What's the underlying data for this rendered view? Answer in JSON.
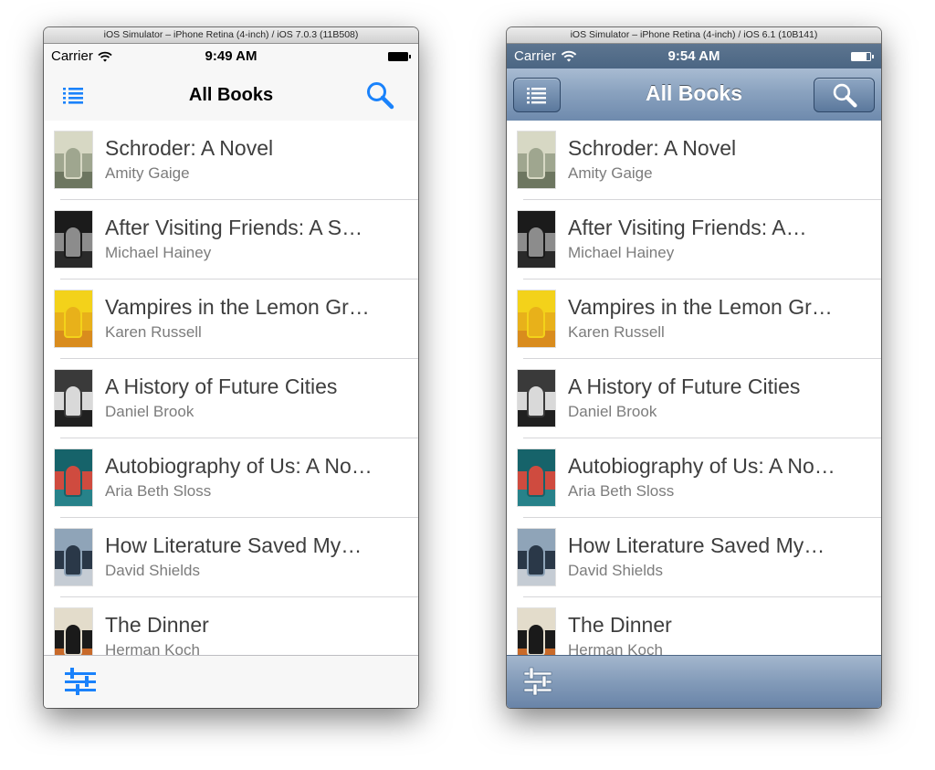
{
  "books": [
    {
      "title": "Schroder: A Novel",
      "author": "Amity Gaige",
      "cover_colors": [
        "#d7d8c4",
        "#9fa68f",
        "#6d7660"
      ]
    },
    {
      "title": "After Visiting Friends: A S…",
      "author": "Michael Hainey",
      "cover_colors": [
        "#1b1b1b",
        "#8c8c8c",
        "#2a2a2a"
      ]
    },
    {
      "title": "Vampires in the Lemon Gr…",
      "author": "Karen Russell",
      "cover_colors": [
        "#f3d21a",
        "#e8b11a",
        "#d98c1d"
      ]
    },
    {
      "title": "A History of Future Cities",
      "author": "Daniel Brook",
      "cover_colors": [
        "#3a3a3a",
        "#d9d9d9",
        "#202020"
      ]
    },
    {
      "title": "Autobiography of Us: A No…",
      "author": "Aria Beth Sloss",
      "cover_colors": [
        "#16636a",
        "#cf4b3f",
        "#27828a"
      ]
    },
    {
      "title": "How Literature Saved My…",
      "author": "David Shields",
      "cover_colors": [
        "#8fa4b8",
        "#2a3848",
        "#c5ccd4"
      ]
    },
    {
      "title": "The Dinner",
      "author": "Herman Koch",
      "cover_colors": [
        "#e3dccb",
        "#1a1a1a",
        "#c86a2a"
      ]
    }
  ],
  "books_ios6": [
    {
      "title": "Schroder: A Novel",
      "author": "Amity Gaige",
      "cover_colors": [
        "#d7d8c4",
        "#9fa68f",
        "#6d7660"
      ]
    },
    {
      "title": "After Visiting Friends: A…",
      "author": "Michael Hainey",
      "cover_colors": [
        "#1b1b1b",
        "#8c8c8c",
        "#2a2a2a"
      ]
    },
    {
      "title": "Vampires in the Lemon Gr…",
      "author": "Karen Russell",
      "cover_colors": [
        "#f3d21a",
        "#e8b11a",
        "#d98c1d"
      ]
    },
    {
      "title": "A History of Future Cities",
      "author": "Daniel Brook",
      "cover_colors": [
        "#3a3a3a",
        "#d9d9d9",
        "#202020"
      ]
    },
    {
      "title": "Autobiography of Us: A No…",
      "author": "Aria Beth Sloss",
      "cover_colors": [
        "#16636a",
        "#cf4b3f",
        "#27828a"
      ]
    },
    {
      "title": "How Literature Saved My…",
      "author": "David Shields",
      "cover_colors": [
        "#8fa4b8",
        "#2a3848",
        "#c5ccd4"
      ]
    },
    {
      "title": "The Dinner",
      "author": "Herman Koch",
      "cover_colors": [
        "#e3dccb",
        "#1a1a1a",
        "#c86a2a"
      ]
    }
  ],
  "left": {
    "simulator_title": "iOS Simulator – iPhone Retina (4-inch) / iOS 7.0.3 (11B508)",
    "status": {
      "carrier": "Carrier",
      "time": "9:49 AM"
    },
    "nav_title": "All Books",
    "icons": {
      "list": "list-icon",
      "search": "search-icon",
      "filter": "sliders-icon"
    },
    "accent_color": "#1a82fb"
  },
  "right": {
    "simulator_title": "iOS Simulator – iPhone Retina (4-inch) / iOS 6.1 (10B141)",
    "status": {
      "carrier": "Carrier",
      "time": "9:54 AM"
    },
    "nav_title": "All Books",
    "icons": {
      "list": "list-icon",
      "search": "search-icon",
      "filter": "sliders-icon"
    },
    "bar_color": "#6e8aad"
  }
}
